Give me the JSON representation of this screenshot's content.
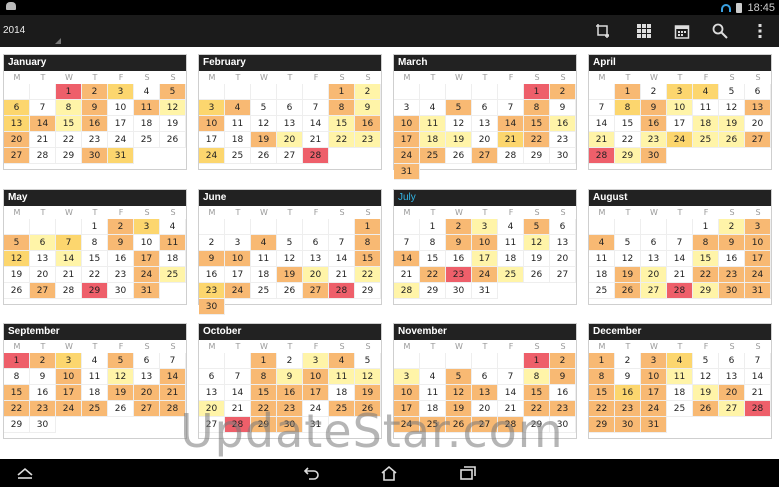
{
  "status": {
    "time": "18:45"
  },
  "toolbar": {
    "year": "2014",
    "icons": [
      "crop-add-icon",
      "grid-view-icon",
      "calendar-icon",
      "search-icon",
      "overflow-menu-icon"
    ]
  },
  "weekdays": [
    "M",
    "T",
    "W",
    "T",
    "F",
    "S",
    "S"
  ],
  "current_month": "July",
  "months": [
    {
      "name": "January",
      "offset": 2,
      "days": 31,
      "heat": {
        "1": 4,
        "2": 3,
        "3": 2,
        "5": 3,
        "6": 2,
        "8": 1,
        "9": 3,
        "11": 3,
        "12": 1,
        "13": 2,
        "14": 3,
        "15": 1,
        "16": 3,
        "20": 3,
        "27": 3,
        "30": 3,
        "31": 2
      }
    },
    {
      "name": "February",
      "offset": 5,
      "days": 28,
      "heat": {
        "1": 3,
        "2": 1,
        "3": 2,
        "4": 3,
        "8": 3,
        "9": 1,
        "10": 3,
        "15": 1,
        "16": 3,
        "19": 3,
        "20": 1,
        "22": 1,
        "23": 1,
        "24": 2,
        "28": 4
      }
    },
    {
      "name": "March",
      "offset": 5,
      "days": 31,
      "heat": {
        "1": 4,
        "2": 3,
        "5": 3,
        "8": 3,
        "10": 3,
        "11": 1,
        "14": 3,
        "15": 3,
        "16": 1,
        "17": 3,
        "18": 1,
        "19": 1,
        "21": 2,
        "22": 3,
        "24": 3,
        "25": 3,
        "27": 3,
        "31": 3
      }
    },
    {
      "name": "April",
      "offset": 1,
      "days": 30,
      "heat": {
        "1": 3,
        "3": 2,
        "4": 2,
        "8": 2,
        "9": 3,
        "10": 1,
        "13": 3,
        "16": 3,
        "18": 1,
        "19": 1,
        "21": 1,
        "23": 1,
        "24": 2,
        "25": 1,
        "26": 1,
        "27": 3,
        "28": 4,
        "29": 1,
        "30": 3
      }
    },
    {
      "name": "May",
      "offset": 3,
      "days": 31,
      "heat": {
        "2": 3,
        "3": 2,
        "5": 3,
        "6": 1,
        "7": 2,
        "9": 3,
        "11": 3,
        "12": 2,
        "14": 1,
        "17": 3,
        "24": 3,
        "25": 1,
        "27": 3,
        "29": 4,
        "31": 3
      }
    },
    {
      "name": "June",
      "offset": 6,
      "days": 30,
      "heat": {
        "1": 3,
        "4": 3,
        "8": 3,
        "9": 3,
        "10": 3,
        "15": 3,
        "19": 3,
        "20": 1,
        "22": 1,
        "23": 2,
        "24": 3,
        "27": 3,
        "28": 4,
        "30": 3
      }
    },
    {
      "name": "July",
      "offset": 1,
      "days": 31,
      "heat": {
        "2": 3,
        "3": 1,
        "5": 3,
        "9": 3,
        "10": 3,
        "12": 1,
        "14": 3,
        "17": 1,
        "22": 3,
        "23": 4,
        "24": 3,
        "25": 1,
        "28": 1
      }
    },
    {
      "name": "August",
      "offset": 4,
      "days": 31,
      "heat": {
        "2": 1,
        "3": 3,
        "4": 3,
        "8": 3,
        "9": 3,
        "10": 3,
        "15": 1,
        "17": 3,
        "19": 3,
        "20": 1,
        "22": 3,
        "23": 3,
        "24": 3,
        "26": 3,
        "27": 1,
        "28": 4,
        "29": 1,
        "30": 3,
        "31": 3
      }
    },
    {
      "name": "September",
      "offset": 0,
      "days": 30,
      "heat": {
        "1": 4,
        "2": 3,
        "3": 2,
        "5": 3,
        "10": 3,
        "12": 1,
        "14": 3,
        "15": 3,
        "17": 3,
        "19": 3,
        "20": 3,
        "21": 3,
        "22": 3,
        "23": 3,
        "24": 3,
        "25": 3,
        "27": 3,
        "28": 3
      }
    },
    {
      "name": "October",
      "offset": 2,
      "days": 31,
      "heat": {
        "1": 3,
        "3": 1,
        "4": 3,
        "8": 3,
        "9": 1,
        "10": 3,
        "11": 1,
        "12": 1,
        "15": 3,
        "16": 3,
        "17": 3,
        "19": 3,
        "20": 1,
        "22": 3,
        "23": 3,
        "25": 3,
        "26": 3,
        "28": 4,
        "29": 3,
        "30": 3
      }
    },
    {
      "name": "November",
      "offset": 5,
      "days": 30,
      "heat": {
        "1": 4,
        "2": 3,
        "3": 1,
        "5": 3,
        "8": 1,
        "9": 3,
        "10": 3,
        "12": 3,
        "13": 3,
        "15": 3,
        "17": 3,
        "19": 3,
        "22": 3,
        "23": 3,
        "24": 3,
        "25": 3,
        "26": 3,
        "27": 3,
        "28": 3
      }
    },
    {
      "name": "December",
      "offset": 0,
      "days": 31,
      "heat": {
        "1": 3,
        "3": 3,
        "4": 2,
        "8": 3,
        "10": 3,
        "11": 1,
        "15": 3,
        "16": 2,
        "17": 3,
        "19": 1,
        "20": 3,
        "22": 3,
        "23": 3,
        "24": 3,
        "26": 3,
        "27": 1,
        "28": 4,
        "29": 3,
        "30": 3,
        "31": 3
      }
    }
  ],
  "watermark": "UpdateStar.com",
  "colors": {
    "level1": "#fff4a8",
    "level2": "#fcd66e",
    "level3": "#f8b973",
    "level4": "#ee5f6a",
    "accent": "#33b5e5"
  }
}
